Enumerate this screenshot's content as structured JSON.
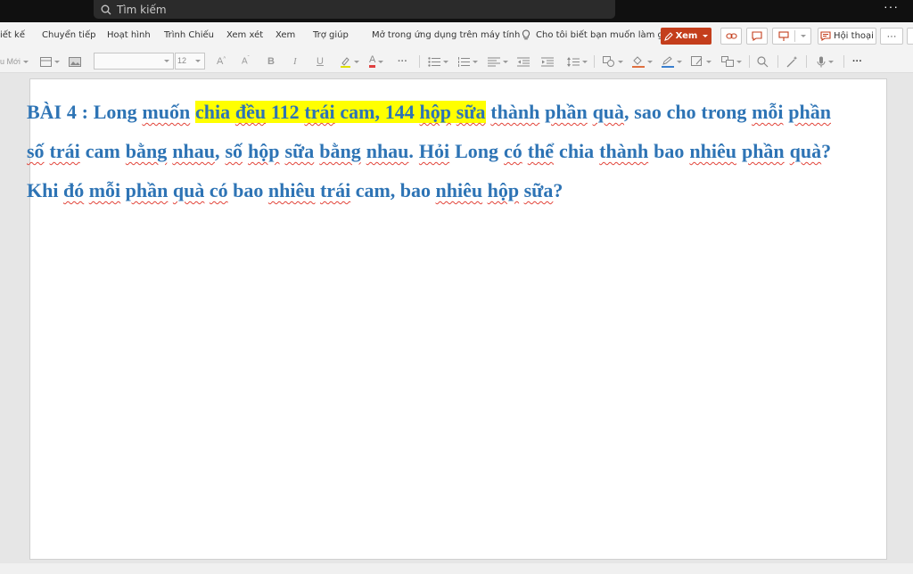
{
  "search": {
    "placeholder": "Tìm kiếm"
  },
  "titlebar": {
    "more": "···"
  },
  "menu": {
    "items": [
      "iết kế",
      "Chuyển tiếp",
      "Hoạt hình",
      "Trình Chiếu",
      "Xem xét",
      "Xem",
      "Trợ giúp",
      "Mở trong ứng dụng trên máy tính"
    ],
    "tell_me": "Cho tôi biết bạn muốn làm gì",
    "view_button": "Xem",
    "chat_button": "Hội thoại",
    "more": "···"
  },
  "toolbar": {
    "new_slide": "u Mới",
    "font_size": "12",
    "bold": "B",
    "italic": "I",
    "underline": "U",
    "more": "···"
  },
  "document": {
    "parts": [
      {
        "text": "BÀI 4 : Long ",
        "hl": false,
        "sq": false
      },
      {
        "text": "muốn",
        "hl": false,
        "sq": true
      },
      {
        "text": " ",
        "hl": false,
        "sq": false
      },
      {
        "text": "chia ",
        "hl": true,
        "sq": false
      },
      {
        "text": "đều",
        "hl": true,
        "sq": true
      },
      {
        "text": " 112 ",
        "hl": true,
        "sq": false
      },
      {
        "text": "trái",
        "hl": true,
        "sq": true
      },
      {
        "text": " cam, 144 ",
        "hl": true,
        "sq": false
      },
      {
        "text": "hộp",
        "hl": true,
        "sq": true
      },
      {
        "text": " ",
        "hl": true,
        "sq": false
      },
      {
        "text": "sữa",
        "hl": true,
        "sq": true
      },
      {
        "text": " ",
        "hl": false,
        "sq": false
      },
      {
        "text": "thành",
        "hl": false,
        "sq": true
      },
      {
        "text": " ",
        "hl": false,
        "sq": false
      },
      {
        "text": "phần",
        "hl": false,
        "sq": true
      },
      {
        "text": " ",
        "hl": false,
        "sq": false
      },
      {
        "text": "quà",
        "hl": false,
        "sq": true
      },
      {
        "text": ", sao cho trong ",
        "hl": false,
        "sq": false
      },
      {
        "text": "mỗi",
        "hl": false,
        "sq": true
      },
      {
        "text": " ",
        "hl": false,
        "sq": false
      },
      {
        "text": "phần",
        "hl": false,
        "sq": true
      },
      {
        "text": " ",
        "hl": false,
        "sq": false
      },
      {
        "text": "số",
        "hl": false,
        "sq": true
      },
      {
        "text": " ",
        "hl": false,
        "sq": false
      },
      {
        "text": "trái",
        "hl": false,
        "sq": true
      },
      {
        "text": " cam ",
        "hl": false,
        "sq": false
      },
      {
        "text": "bằng",
        "hl": false,
        "sq": true
      },
      {
        "text": " ",
        "hl": false,
        "sq": false
      },
      {
        "text": "nhau",
        "hl": false,
        "sq": true
      },
      {
        "text": ", ",
        "hl": false,
        "sq": false
      },
      {
        "text": "số",
        "hl": false,
        "sq": true
      },
      {
        "text": " ",
        "hl": false,
        "sq": false
      },
      {
        "text": "hộp",
        "hl": false,
        "sq": true
      },
      {
        "text": " ",
        "hl": false,
        "sq": false
      },
      {
        "text": "sữa",
        "hl": false,
        "sq": true
      },
      {
        "text": " ",
        "hl": false,
        "sq": false
      },
      {
        "text": "bằng",
        "hl": false,
        "sq": true
      },
      {
        "text": " ",
        "hl": false,
        "sq": false
      },
      {
        "text": "nhau",
        "hl": false,
        "sq": true
      },
      {
        "text": ". ",
        "hl": false,
        "sq": false
      },
      {
        "text": "Hỏi",
        "hl": false,
        "sq": true
      },
      {
        "text": " Long ",
        "hl": false,
        "sq": false
      },
      {
        "text": "có",
        "hl": false,
        "sq": true
      },
      {
        "text": " ",
        "hl": false,
        "sq": false
      },
      {
        "text": "thể",
        "hl": false,
        "sq": true
      },
      {
        "text": " chia ",
        "hl": false,
        "sq": false
      },
      {
        "text": "thành",
        "hl": false,
        "sq": true
      },
      {
        "text": " bao ",
        "hl": false,
        "sq": false
      },
      {
        "text": "nhiêu",
        "hl": false,
        "sq": true
      },
      {
        "text": " ",
        "hl": false,
        "sq": false
      },
      {
        "text": "phần",
        "hl": false,
        "sq": true
      },
      {
        "text": " ",
        "hl": false,
        "sq": false
      },
      {
        "text": "quà",
        "hl": false,
        "sq": true
      },
      {
        "text": "? Khi ",
        "hl": false,
        "sq": false
      },
      {
        "text": "đó",
        "hl": false,
        "sq": true
      },
      {
        "text": " ",
        "hl": false,
        "sq": false
      },
      {
        "text": "mỗi",
        "hl": false,
        "sq": true
      },
      {
        "text": " ",
        "hl": false,
        "sq": false
      },
      {
        "text": "phần",
        "hl": false,
        "sq": true
      },
      {
        "text": " ",
        "hl": false,
        "sq": false
      },
      {
        "text": "quà",
        "hl": false,
        "sq": true
      },
      {
        "text": " ",
        "hl": false,
        "sq": false
      },
      {
        "text": "có",
        "hl": false,
        "sq": true
      },
      {
        "text": " bao ",
        "hl": false,
        "sq": false
      },
      {
        "text": "nhiêu",
        "hl": false,
        "sq": true
      },
      {
        "text": " ",
        "hl": false,
        "sq": false
      },
      {
        "text": "trái",
        "hl": false,
        "sq": true
      },
      {
        "text": " cam, bao ",
        "hl": false,
        "sq": false
      },
      {
        "text": "nhiêu",
        "hl": false,
        "sq": true
      },
      {
        "text": " ",
        "hl": false,
        "sq": false
      },
      {
        "text": "hộp",
        "hl": false,
        "sq": true
      },
      {
        "text": " ",
        "hl": false,
        "sq": false
      },
      {
        "text": "sữa",
        "hl": false,
        "sq": true
      },
      {
        "text": "?",
        "hl": false,
        "sq": false
      }
    ]
  },
  "colors": {
    "accent": "#c43e1c",
    "text": "#2e74b5",
    "highlight": "#ffff00",
    "spellcheck": "#e2443a"
  }
}
